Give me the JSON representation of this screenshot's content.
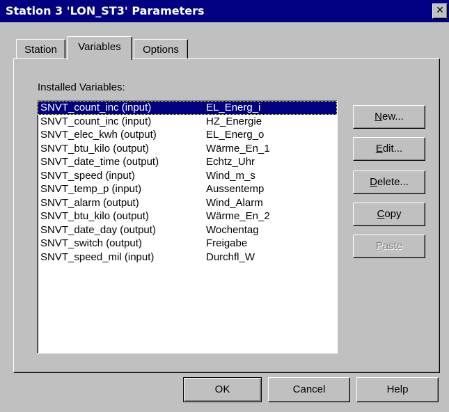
{
  "window": {
    "title": "Station 3 'LON_ST3' Parameters",
    "close_glyph": "✕"
  },
  "tabs": [
    {
      "label": "Station",
      "active": false
    },
    {
      "label": "Variables",
      "active": true
    },
    {
      "label": "Options",
      "active": false
    }
  ],
  "variables_panel": {
    "list_label": "Installed Variables:",
    "items": [
      {
        "type": "SNVT_count_inc (input)",
        "name": "EL_Energ_i",
        "selected": true
      },
      {
        "type": "SNVT_count_inc (input)",
        "name": "HZ_Energie",
        "selected": false
      },
      {
        "type": "SNVT_elec_kwh (output)",
        "name": "EL_Energ_o",
        "selected": false
      },
      {
        "type": "SNVT_btu_kilo (output)",
        "name": "Wärme_En_1",
        "selected": false
      },
      {
        "type": "SNVT_date_time (output)",
        "name": "Echtz_Uhr",
        "selected": false
      },
      {
        "type": "SNVT_speed (input)",
        "name": "Wind_m_s",
        "selected": false
      },
      {
        "type": "SNVT_temp_p (input)",
        "name": "Aussentemp",
        "selected": false
      },
      {
        "type": "SNVT_alarm (output)",
        "name": "Wind_Alarm",
        "selected": false
      },
      {
        "type": "SNVT_btu_kilo (output)",
        "name": "Wärme_En_2",
        "selected": false
      },
      {
        "type": "SNVT_date_day (output)",
        "name": "Wochentag",
        "selected": false
      },
      {
        "type": "SNVT_switch (output)",
        "name": "Freigabe",
        "selected": false
      },
      {
        "type": "SNVT_speed_mil (input)",
        "name": "Durchfl_W",
        "selected": false
      }
    ],
    "buttons": {
      "new": {
        "accel": "N",
        "rest": "ew..."
      },
      "edit": {
        "accel": "E",
        "rest": "dit..."
      },
      "delete": {
        "accel": "D",
        "rest": "elete..."
      },
      "copy": {
        "accel": "C",
        "rest": "opy"
      },
      "paste": {
        "accel": "P",
        "rest": "aste",
        "disabled": true
      }
    }
  },
  "footer": {
    "ok_label": "OK",
    "cancel_label": "Cancel",
    "help_label": "Help"
  }
}
